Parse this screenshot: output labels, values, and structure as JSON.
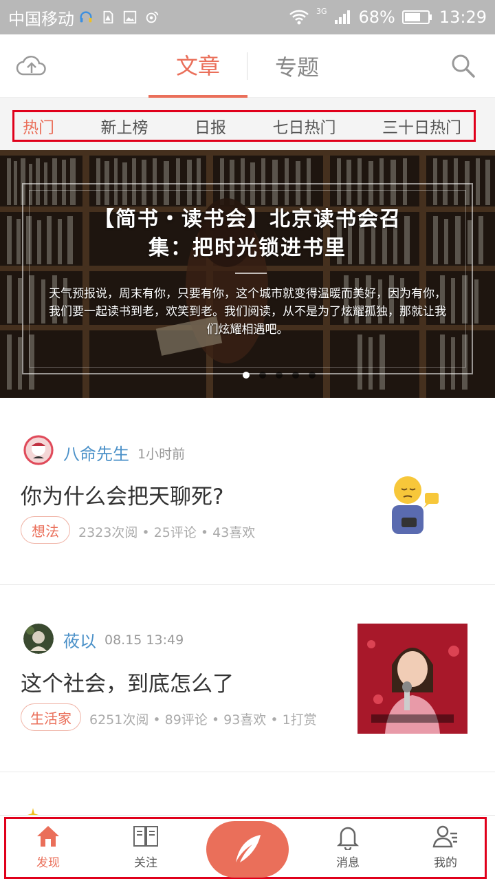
{
  "status_bar": {
    "carrier": "中国移动",
    "network": "3G",
    "battery": "68%",
    "time": "13:29"
  },
  "header": {
    "tabs": [
      {
        "label": "文章",
        "active": true
      },
      {
        "label": "专题",
        "active": false
      }
    ],
    "icons": [
      "cloud-upload-icon",
      "search-icon"
    ]
  },
  "subtabs": [
    {
      "label": "热门",
      "active": true
    },
    {
      "label": "新上榜",
      "active": false
    },
    {
      "label": "日报",
      "active": false
    },
    {
      "label": "七日热门",
      "active": false
    },
    {
      "label": "三十日热门",
      "active": false
    }
  ],
  "banner": {
    "title_line1": "【简书・读书会】北京读书会召",
    "title_line2": "集：把时光锁进书里",
    "description": "天气预报说，周末有你，只要有你，这个城市就变得温暖而美好，因为有你，我们要一起读书到老，欢笑到老。我们阅读，从不是为了炫耀孤独，那就让我们炫耀相遇吧。",
    "slide_count": 5,
    "active_slide": 1
  },
  "feed": [
    {
      "author": "八命先生",
      "time": "1小时前",
      "title": "你为什么会把天聊死?",
      "tag": "想法",
      "stats": "2323次阅 • 25评论 • 43喜欢"
    },
    {
      "author": "莜以",
      "time": "08.15 13:49",
      "title": "这个社会，到底怎么了",
      "tag": "生活家",
      "stats": "6251次阅 • 89评论 • 93喜欢 • 1打赏"
    }
  ],
  "bottom_nav": [
    {
      "label": "发现",
      "icon": "home-icon",
      "active": true
    },
    {
      "label": "关注",
      "icon": "book-icon",
      "active": false
    },
    {
      "label": "",
      "icon": "feather-pen-icon",
      "active": false
    },
    {
      "label": "消息",
      "icon": "bell-icon",
      "active": false
    },
    {
      "label": "我的",
      "icon": "user-icon",
      "active": false
    }
  ],
  "colors": {
    "accent": "#ea6f5a",
    "link": "#4a90c8",
    "highlight_box": "#e0001b"
  }
}
